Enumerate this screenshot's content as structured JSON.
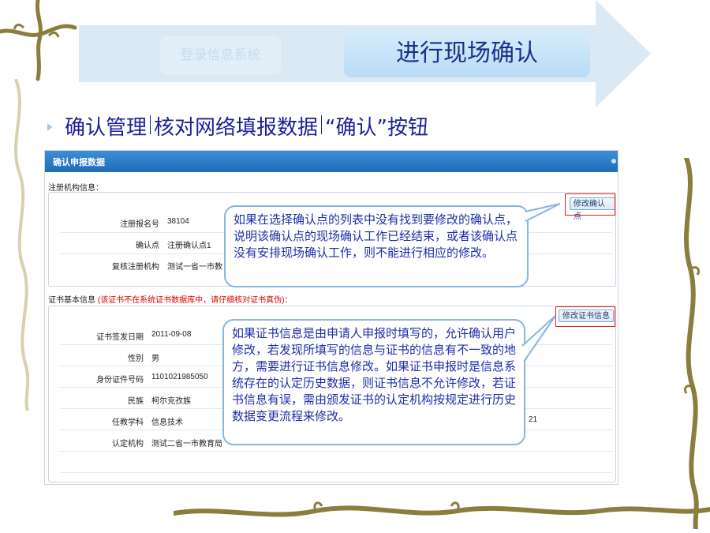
{
  "steps": {
    "previous": "登录信息系统",
    "current": "进行现场确认"
  },
  "heading": {
    "part1": "确认管理",
    "part2": "核对网络填报数据",
    "part3": "“确认”按钮"
  },
  "screenshot": {
    "panel_title": "确认申报数据",
    "section_registration": "注册机构信息：",
    "modify_point_button": "修改确认点",
    "fields_registration": [
      {
        "label": "注册报名号",
        "value": "38104"
      },
      {
        "label": "确认点",
        "value": "注册确认点1"
      },
      {
        "label": "复核注册机构",
        "value": "测试一省一市教"
      }
    ],
    "section_certificate": "证书基本信息",
    "section_certificate_warning": "(该证书不在系统证书数据库中，请仔细核对证书真伪)：",
    "modify_cert_button": "修改证书信息",
    "fields_certificate": [
      {
        "label": "证书签发日期",
        "value": "2011-09-08"
      },
      {
        "label": "性别",
        "value": "男"
      },
      {
        "label": "身份证件号码",
        "value": "1101021985050"
      },
      {
        "label": "民族",
        "value": "柯尔克孜族"
      },
      {
        "label": "任教学科",
        "value": "信息技术"
      },
      {
        "label": "认定机构",
        "value": "测试二省一市教育局"
      }
    ],
    "partial_digits": "21"
  },
  "callouts": {
    "confirm_point": "如果在选择确认点的列表中没有找到要修改的确认点，说明该确认点的现场确认工作已经结束，或者该确认点没有安排现场确认工作，则不能进行相应的修改。",
    "certificate": "如果证书信息是由申请人申报时填写的，允许确认用户修改，若发现所填写的信息与证书的信息有不一致的地方，需要进行证书信息修改。如果证书申报时是信息系统存在的认定历史数据，则证书信息不允许修改，若证书信息有误，需由颁发证书的认定机构按规定进行历史数据变更流程来修改。"
  },
  "colors": {
    "heading": "#1b1f9a",
    "callout_text": "#1d2ea8",
    "callout_border": "#88b4e6",
    "panel_bar": "#1e6cb8",
    "warning": "#dd0000"
  }
}
